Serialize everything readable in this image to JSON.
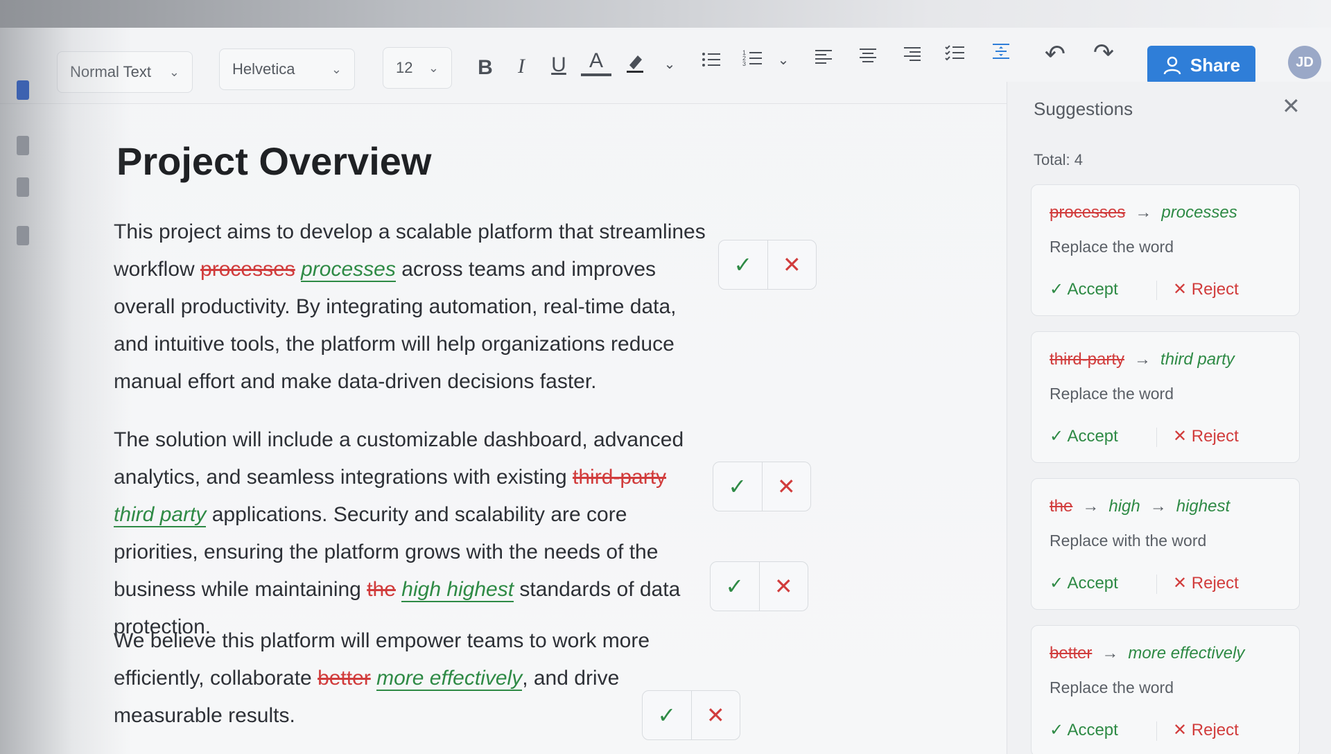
{
  "toolbar": {
    "style_select": "Normal Text",
    "font_select": "Helvetica",
    "size_select": "12",
    "share_label": "Share",
    "avatar_initials": "JD"
  },
  "document": {
    "title": "Project Overview",
    "para1": {
      "text_a": "This project aims to develop a scalable platform that streamlines workflow",
      "del": "processes",
      "ins": "processes",
      "text_b": "across teams and improves overall productivity. By integrating automation, real-time data, and intuitive tools, the platform will help organizations reduce manual effort and make data-driven decisions faster."
    },
    "para2": {
      "text_a": "The solution will include a customizable dashboard, advanced analytics, and seamless integrations with existing",
      "del1": "third-party",
      "ins1": "third party",
      "text_b": "applications. Security and scalability are core priorities, ensuring the platform grows with the needs of the business while maintaining",
      "del2": "the",
      "ins2": "high highest",
      "text_c": "standards of data protection."
    },
    "para3": {
      "text_a": "We believe this platform will empower teams to work more efficiently, collaborate",
      "del": "better",
      "ins": "more effectively",
      "text_b": ", and drive measurable results."
    }
  },
  "panel": {
    "title": "Suggestions",
    "total": "Total: 4",
    "accept_label": "Accept",
    "reject_label": "Reject",
    "cards": [
      {
        "from": "processes",
        "to": "processes",
        "desc": "Replace the word"
      },
      {
        "from": "third-party",
        "to": "third party",
        "desc": "Replace the word"
      },
      {
        "from": "the",
        "mid": "high",
        "to": "highest",
        "desc": "Replace with the word"
      },
      {
        "from": "better",
        "to": "more effectively",
        "desc": "Replace the word"
      }
    ]
  },
  "colors": {
    "accent": "#2f7ed8",
    "accept": "#2e8a45",
    "reject": "#d13c3c"
  }
}
